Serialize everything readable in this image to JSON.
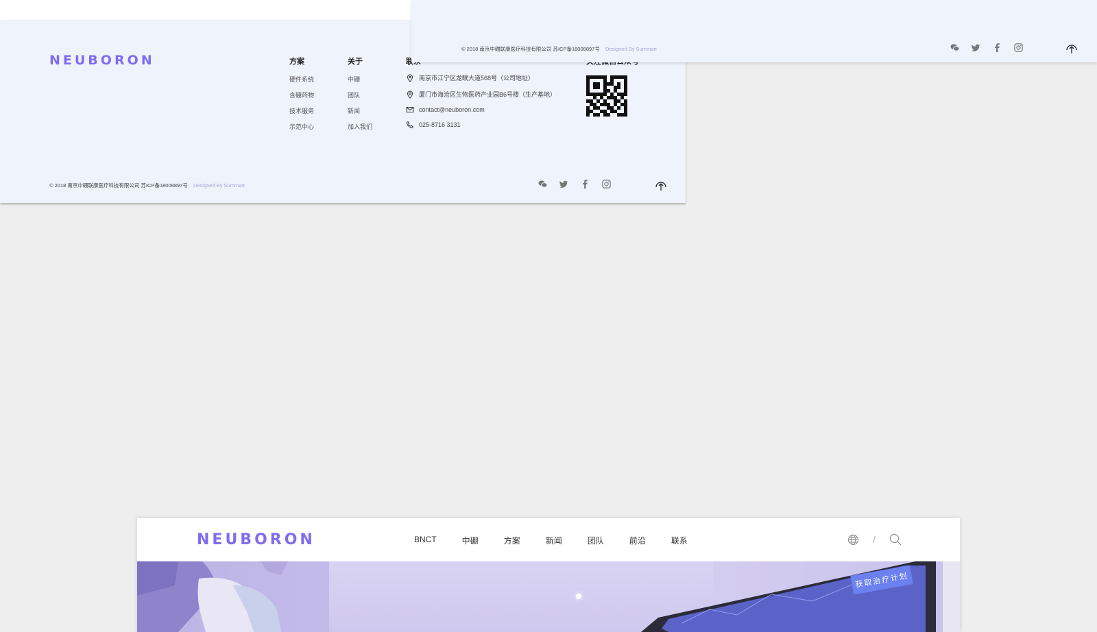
{
  "brand": {
    "logo_text": "NEUBORON",
    "accent": "#7f6cf0"
  },
  "footer": {
    "columns": [
      {
        "title": "方案",
        "links": [
          "硬件系统",
          "含硼药物",
          "技术服务",
          "示范中心"
        ]
      },
      {
        "title": "关于",
        "links": [
          "中硼",
          "团队",
          "新闻",
          "加入我们"
        ]
      }
    ],
    "contact": {
      "title": "联系",
      "items": [
        {
          "icon": "location-icon",
          "text": "南京市江宁区龙眠大道568号（公司地址）"
        },
        {
          "icon": "location-icon",
          "text": "厦门市海沧区生物医药产业园B6号楼（生产基地）"
        },
        {
          "icon": "mail-icon",
          "text": "contact@neuboron.com"
        },
        {
          "icon": "phone-icon",
          "text": "025-8716 3131"
        }
      ]
    },
    "qr_title": "关注微信公众号",
    "copyright": "© 2018 南京中硼联康医疗科技有限公司  苏ICP备18008897号",
    "designer": "Designed By Summart",
    "social_icons": [
      "wechat-icon",
      "twitter-icon",
      "facebook-icon",
      "instagram-icon"
    ],
    "back_to_top_icon": "upload-arrow-icon"
  },
  "overlay": {
    "copyright": "© 2018 南京中硼联康医疗科技有限公司  苏ICP备18008897号",
    "designer": "Designed By Summart"
  },
  "header": {
    "nav": [
      "BNCT",
      "中硼",
      "方案",
      "新闻",
      "团队",
      "前沿",
      "联系"
    ],
    "language_icon": "globe-icon",
    "separator": "/",
    "search_icon": "search-icon"
  },
  "hero": {
    "button_label": "获取治疗计划"
  }
}
